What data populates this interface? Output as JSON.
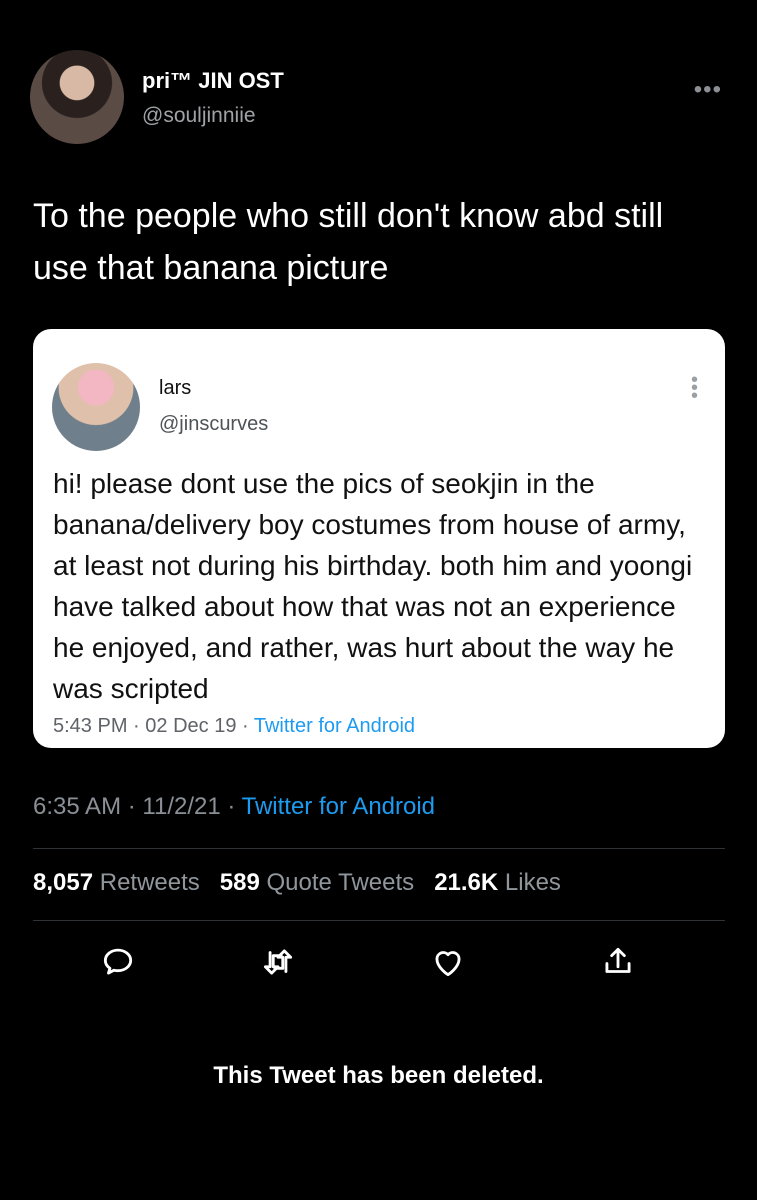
{
  "tweet": {
    "display_name": "pri™ JIN OST",
    "username": "@souljinniie",
    "text": "To the people who still don't know abd still use that banana picture",
    "time": "6:35 AM",
    "date": "11/2/21",
    "source": "Twitter for Android"
  },
  "quote": {
    "display_name": "lars",
    "username": "@jinscurves",
    "text": "hi! please dont use the pics of seokjin in the banana/delivery boy costumes from house of army, at least not during his birthday. both him and yoongi have talked about how that was not an experience he enjoyed, and rather, was hurt about the way he was scripted",
    "time": "5:43 PM",
    "date": "02 Dec 19",
    "source": "Twitter for Android"
  },
  "stats": {
    "retweets_count": "8,057",
    "retweets_label": "Retweets",
    "quote_tweets_count": "589",
    "quote_tweets_label": "Quote Tweets",
    "likes_count": "21.6K",
    "likes_label": "Likes"
  },
  "actions": [
    {
      "name": "reply",
      "icon": "reply-icon"
    },
    {
      "name": "retweet",
      "icon": "retweet-icon"
    },
    {
      "name": "like",
      "icon": "heart-icon"
    },
    {
      "name": "share",
      "icon": "share-icon"
    }
  ],
  "notice": {
    "deleted_text": "This Tweet has been deleted."
  },
  "colors": {
    "background": "#000000",
    "text": "#ffffff",
    "muted": "#8a9096",
    "accent": "#1d9bf0"
  }
}
